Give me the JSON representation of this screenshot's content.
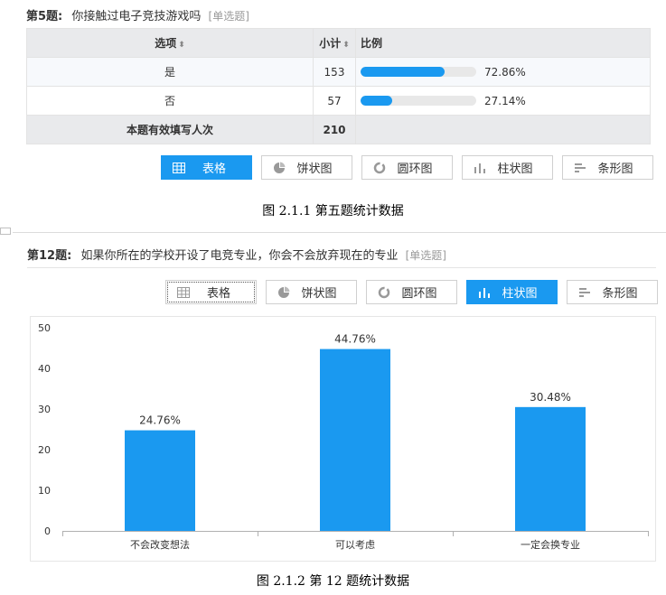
{
  "q5": {
    "number": "第5题:",
    "text": "你接触过电子竞技游戏吗",
    "type": "[单选题]",
    "table": {
      "headers": [
        "选项",
        "小计",
        "比例"
      ],
      "sort_glyph": "⬍",
      "rows": [
        {
          "option": "是",
          "count": "153",
          "percent": "72.86%",
          "fraction": 0.7286
        },
        {
          "option": "否",
          "count": "57",
          "percent": "27.14%",
          "fraction": 0.2714
        }
      ],
      "total_label": "本题有效填写人次",
      "total_count": "210"
    },
    "view_buttons": [
      "表格",
      "饼状图",
      "圆环图",
      "柱状图",
      "条形图"
    ],
    "active_view": "表格"
  },
  "caption1": "图 2.1.1  第五题统计数据",
  "q12": {
    "number": "第12题:",
    "text": "如果你所在的学校开设了电竞专业，你会不会放弃现在的专业",
    "type": "[单选题]",
    "view_buttons": [
      "表格",
      "饼状图",
      "圆环图",
      "柱状图",
      "条形图"
    ],
    "active_view": "柱状图"
  },
  "chart_data": {
    "type": "bar",
    "categories": [
      "不会改变想法",
      "可以考虑",
      "一定会换专业"
    ],
    "values": [
      24.76,
      44.76,
      30.48
    ],
    "data_labels": [
      "24.76%",
      "44.76%",
      "30.48%"
    ],
    "ylim": [
      0,
      50
    ],
    "yticks": [
      "0",
      "10",
      "20",
      "30",
      "40",
      "50"
    ],
    "grid": false,
    "bar_color": "#1a99f0"
  },
  "caption2": "图 2.1.2  第 12 题统计数据",
  "colors": {
    "accent": "#1a99f0",
    "header_bg": "#e9eaec",
    "track": "#e8e8e8"
  }
}
